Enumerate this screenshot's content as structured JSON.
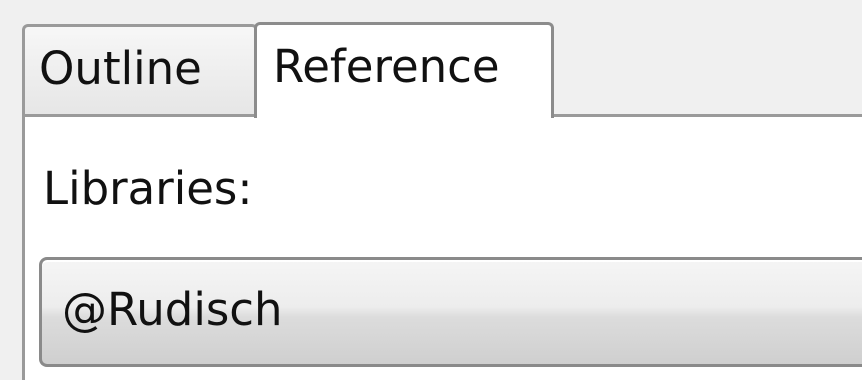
{
  "tabs": [
    {
      "label": "Outline",
      "selected": false
    },
    {
      "label": "Reference",
      "selected": true
    }
  ],
  "panel": {
    "libraries_label": "Libraries:",
    "library_value": "@Rudisch"
  }
}
